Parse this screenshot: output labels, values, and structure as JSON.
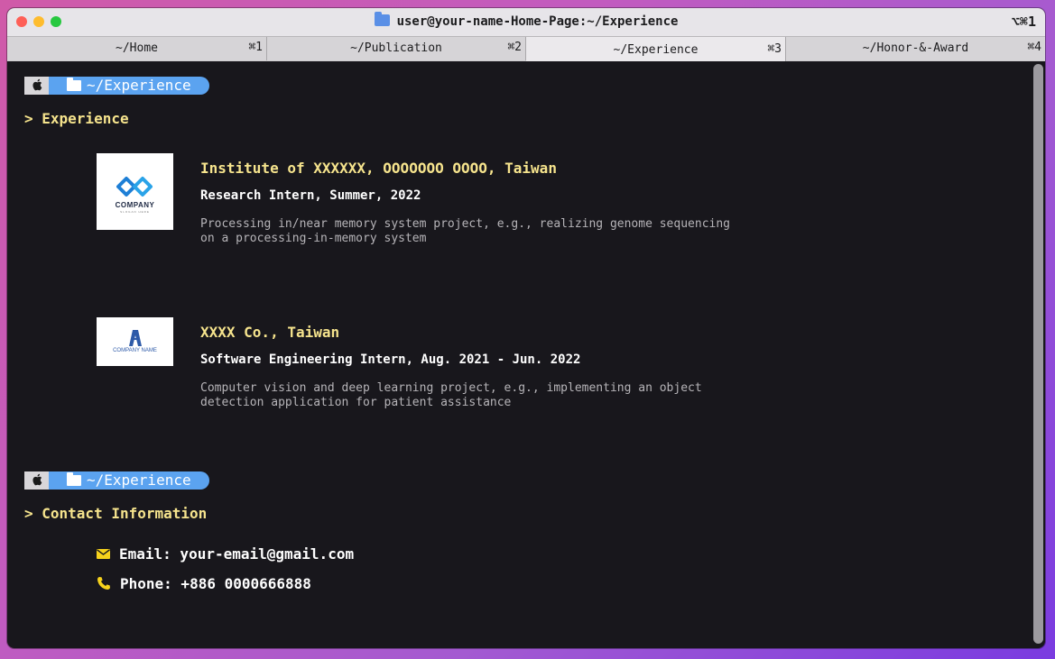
{
  "window": {
    "title": "user@your-name-Home-Page:~/Experience",
    "shortcut": "⌥⌘1"
  },
  "tabs": [
    {
      "label": "~/Home",
      "key": "⌘1"
    },
    {
      "label": "~/Publication",
      "key": "⌘2"
    },
    {
      "label": "~/Experience",
      "key": "⌘3",
      "active": true
    },
    {
      "label": "~/Honor-&-Award",
      "key": "⌘4"
    }
  ],
  "prompt": {
    "apple": "",
    "path": "~/Experience"
  },
  "sections": {
    "experience_heading": "> Experience",
    "contact_heading": "> Contact Information"
  },
  "experience": [
    {
      "logo_text": "COMPANY",
      "logo_sub": "SLOGAN HERE",
      "org": "Institute of XXXXXX, OOOOOOO OOOO, Taiwan",
      "role": "Research Intern, Summer, 2022",
      "desc_line1": "Processing in/near memory system project, e.g., realizing genome sequencing",
      "desc_line2": "on a processing-in-memory system"
    },
    {
      "logo_text": "COMPANY NAME",
      "org": "XXXX Co., Taiwan",
      "role": "Software Engineering Intern, Aug. 2021 - Jun. 2022",
      "desc_line1": "Computer vision and deep learning project, e.g., implementing an object",
      "desc_line2": "detection application for patient assistance"
    }
  ],
  "contact": {
    "email": "Email: your-email@gmail.com",
    "phone": "Phone: +886 0000666888"
  },
  "colors": {
    "accent_yellow": "#f6e48d",
    "prompt_blue": "#5ba3f0",
    "background": "#18171c"
  }
}
